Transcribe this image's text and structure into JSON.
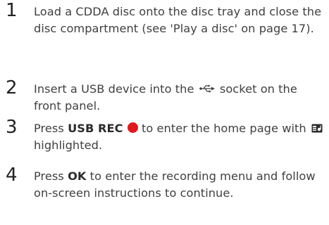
{
  "steps": [
    {
      "number": "1",
      "text": "Load a CDDA disc onto the disc tray and close the disc compartment (see 'Play a disc' on page 17)."
    },
    {
      "number": "2",
      "before": "Insert a USB device into the",
      "after": "socket on the front panel.",
      "icon": "usb-icon"
    },
    {
      "number": "3",
      "before": "Press",
      "key": "USB REC",
      "middle": "to enter the home page with",
      "after": "highlighted.",
      "icons": [
        "record-dot-icon",
        "mp3-icon"
      ]
    },
    {
      "number": "4",
      "before": "Press",
      "key": "OK",
      "after": "to enter the recording menu and follow on-screen instructions to continue."
    }
  ],
  "colors": {
    "record_dot": "#e0191d",
    "text": "#404040",
    "number": "#222222"
  }
}
